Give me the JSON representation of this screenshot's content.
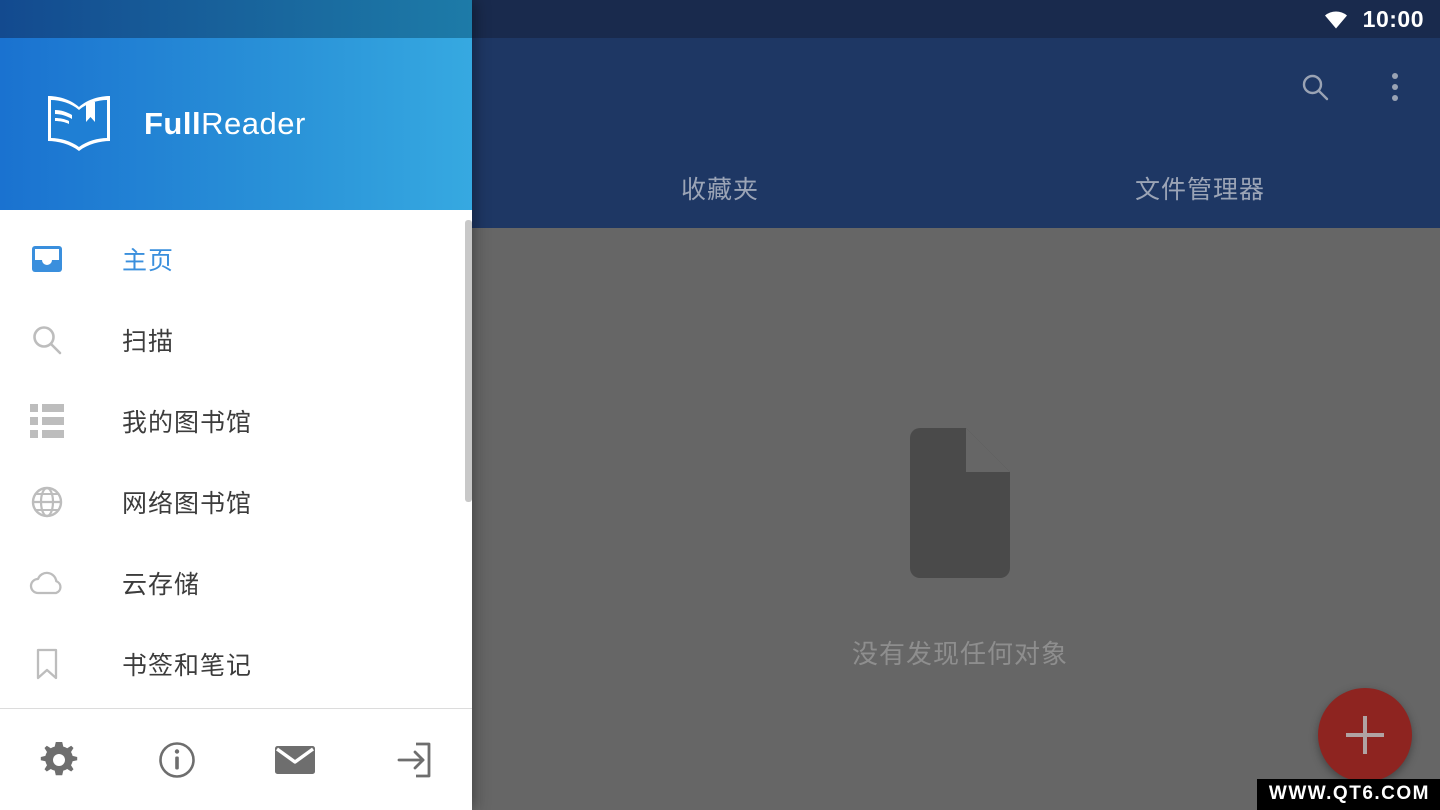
{
  "statusbar": {
    "time": "10:00",
    "wifi_icon": "wifi-icon"
  },
  "appbar": {
    "search_icon": "search-icon",
    "overflow_icon": "overflow-menu-icon",
    "tabs": [
      {
        "label": "收藏夹",
        "active": false
      },
      {
        "label": "文件管理器",
        "active": false
      }
    ]
  },
  "content": {
    "empty_icon": "document-icon",
    "empty_text": "没有发现任何对象",
    "fab_label": "+",
    "fab_icon": "plus-icon",
    "fab_color": "#8e2420"
  },
  "watermark": {
    "text": "WWW.QT6.COM"
  },
  "drawer": {
    "brand": {
      "bold": "Full",
      "light": "Reader",
      "logo_icon": "open-book-logo-icon"
    },
    "header_gradient_start": "#1a72d0",
    "header_gradient_end": "#36a9e1",
    "active_color": "#3a8fdd",
    "items": [
      {
        "label": "主页",
        "icon": "inbox-icon",
        "active": true
      },
      {
        "label": "扫描",
        "icon": "search-icon",
        "active": false
      },
      {
        "label": "我的图书馆",
        "icon": "list-icon",
        "active": false
      },
      {
        "label": "网络图书馆",
        "icon": "globe-icon",
        "active": false
      },
      {
        "label": "云存储",
        "icon": "cloud-icon",
        "active": false
      },
      {
        "label": "书签和笔记",
        "icon": "bookmark-icon",
        "active": false
      }
    ],
    "footer": [
      {
        "icon": "gear-icon",
        "name": "settings-button"
      },
      {
        "icon": "info-icon",
        "name": "about-button"
      },
      {
        "icon": "mail-icon",
        "name": "feedback-button"
      },
      {
        "icon": "exit-icon",
        "name": "exit-button"
      }
    ]
  }
}
